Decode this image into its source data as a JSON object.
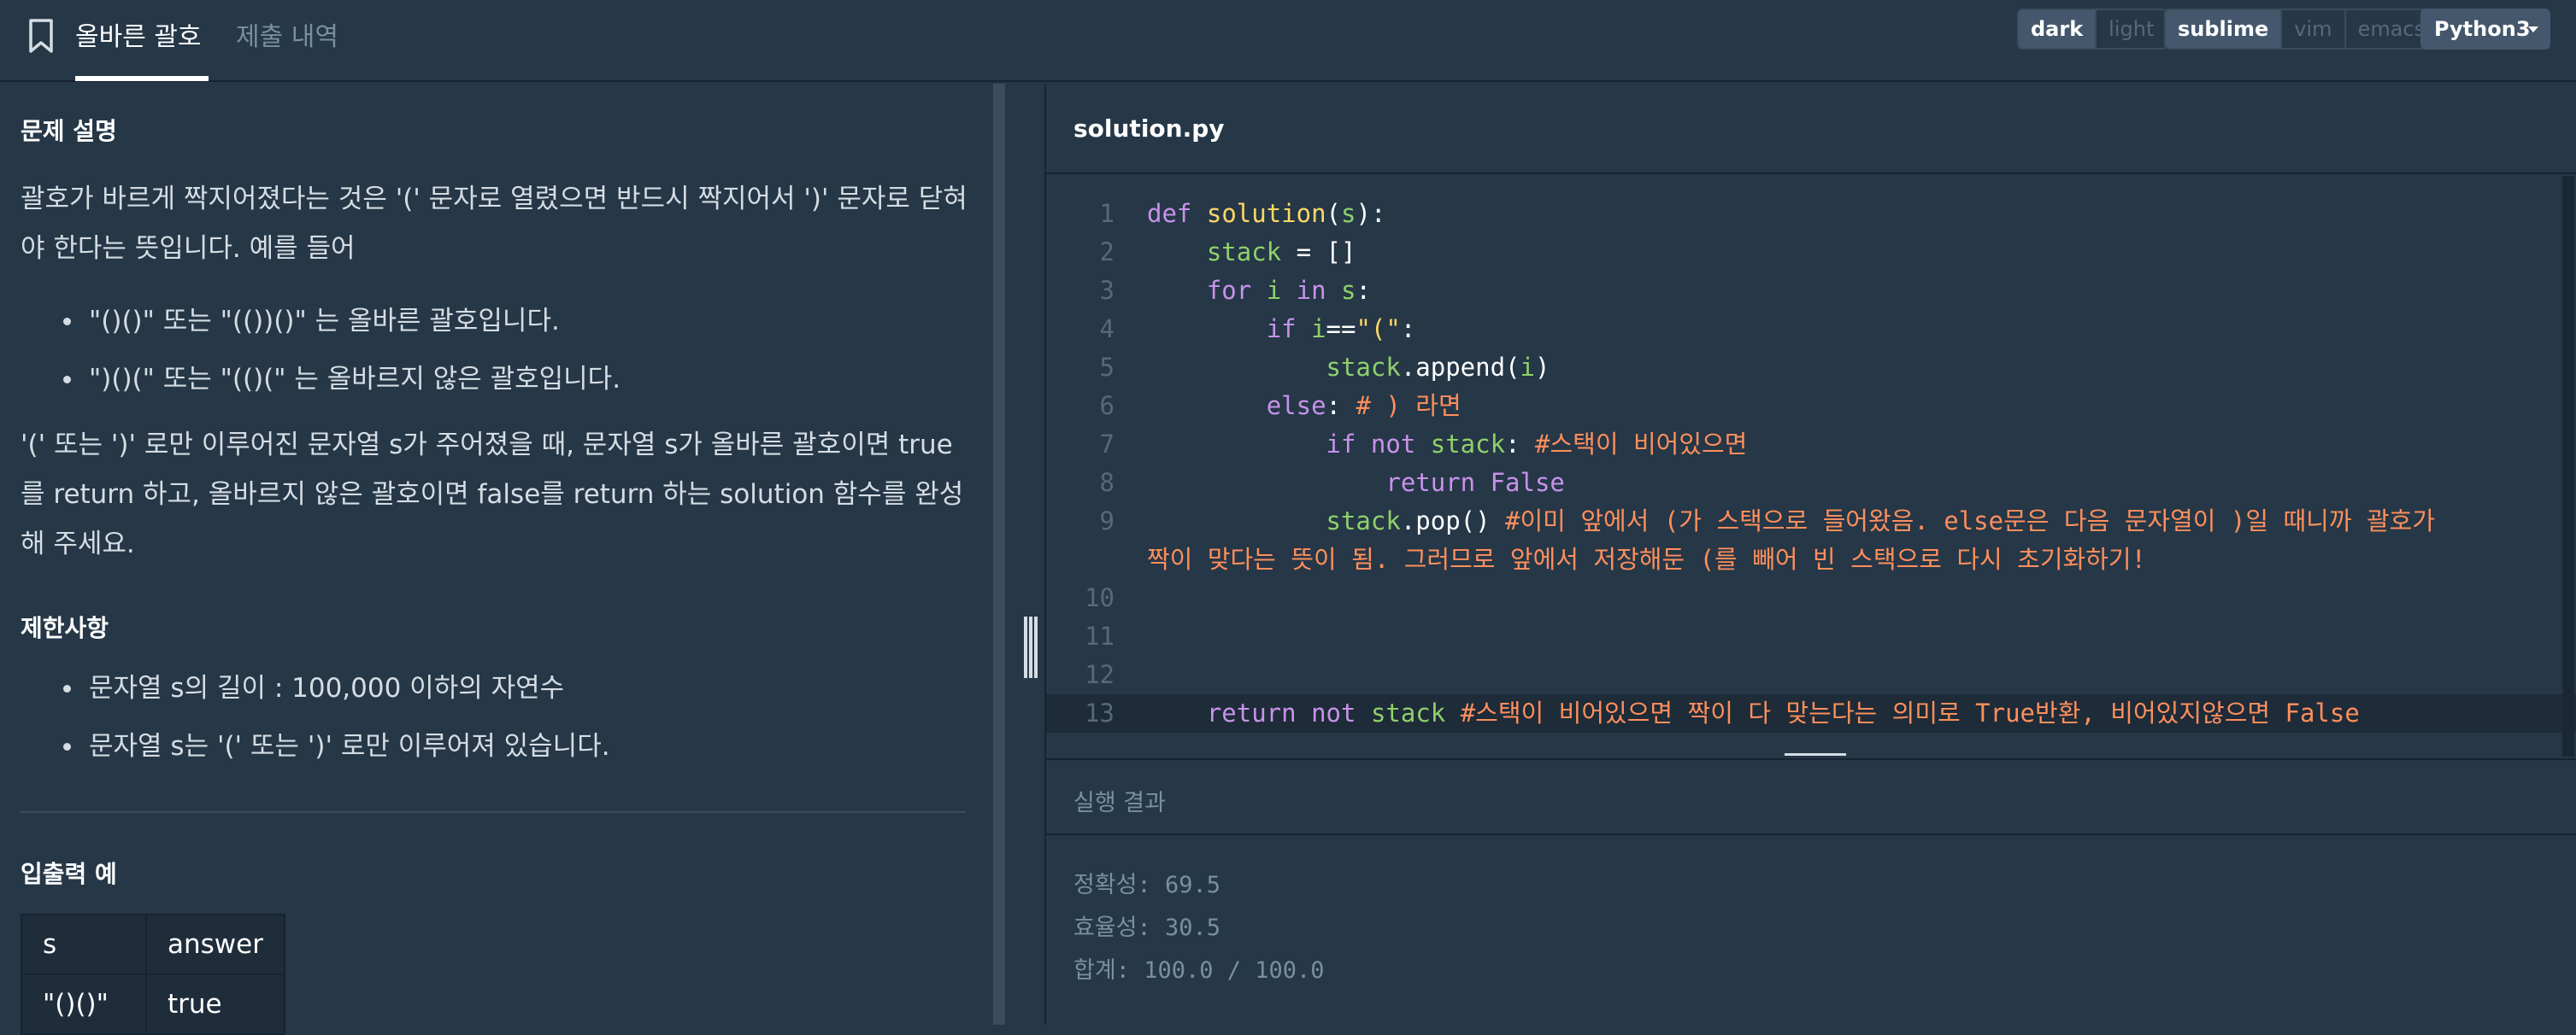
{
  "topbar": {
    "tabs": [
      {
        "label": "올바른 괄호"
      },
      {
        "label": "제출 내역"
      }
    ],
    "theme": {
      "options": [
        "dark",
        "light"
      ],
      "selected": "dark"
    },
    "keymap": {
      "options": [
        "sublime",
        "vim",
        "emacs"
      ],
      "selected": "sublime"
    },
    "language": "Python3"
  },
  "problem": {
    "desc_title": "문제 설명",
    "desc_p1": "괄호가 바르게 짝지어졌다는 것은 '(' 문자로 열렸으면 반드시 짝지어서 ')' 문자로 닫혀야 한다는 뜻입니다. 예를 들어",
    "examples": [
      "\"()()\" 또는 \"(())()\" 는 올바른 괄호입니다.",
      "\")()(\" 또는 \"(()(\" 는 올바르지 않은 괄호입니다."
    ],
    "desc_p2": "'(' 또는 ')' 로만 이루어진 문자열 s가 주어졌을 때, 문자열 s가 올바른 괄호이면 true를 return 하고, 올바르지 않은 괄호이면 false를 return 하는 solution 함수를 완성해 주세요.",
    "limits_title": "제한사항",
    "limits": [
      "문자열 s의 길이 : 100,000 이하의 자연수",
      "문자열 s는 '(' 또는 ')' 로만 이루어져 있습니다."
    ],
    "io_title": "입출력 예",
    "io_table": {
      "headers": [
        "s",
        "answer"
      ],
      "rows": [
        [
          "\"()()\"",
          "true"
        ]
      ]
    }
  },
  "editor": {
    "file_name": "solution.py",
    "line_numbers": [
      "1",
      "2",
      "3",
      "4",
      "5",
      "6",
      "7",
      "8",
      "9",
      "10",
      "11",
      "12",
      "13"
    ],
    "code": {
      "l1": {
        "def": "def",
        "fn": "solution",
        "p1": "(",
        "arg": "s",
        "p2": "):"
      },
      "l2": {
        "v": "stack",
        "rest": " = []"
      },
      "l3": {
        "for": "for",
        "i": "i",
        "in": "in",
        "s": "s",
        "colon": ":"
      },
      "l4": {
        "if": "if",
        "i": "i",
        "op": "==",
        "str": "\"(\"",
        "colon": ":"
      },
      "l5": {
        "v": "stack",
        "method": ".append(",
        "i": "i",
        "close": ")"
      },
      "l6": {
        "else": "else",
        "colon": ": ",
        "comment": "# ) 라면"
      },
      "l7": {
        "if": "if",
        "not": "not",
        "v": "stack",
        "colon": ": ",
        "comment": "#스택이 비어있으면"
      },
      "l8": {
        "return": "return",
        "val": "False"
      },
      "l9": {
        "v": "stack",
        "method": ".pop() ",
        "comment": "#이미 앞에서 (가 스택으로 들어왔음. else문은 다음 문자열이 )일 때니까 괄호가",
        "comment_wrap": "짝이 맞다는 뜻이 됨. 그러므로 앞에서 저장해둔 (를 빼어 빈 스택으로 다시 초기화하기!"
      },
      "l13": {
        "return": "return",
        "not": "not",
        "v": "stack",
        "comment": "#스택이 비어있으면 짝이 다 맞는다는 의미로 True반환, 비어있지않으면 False"
      }
    }
  },
  "result": {
    "title": "실행 결과",
    "lines": [
      "정확성: 69.5",
      "효율성: 30.5",
      "합계: 100.0 / 100.0"
    ]
  }
}
